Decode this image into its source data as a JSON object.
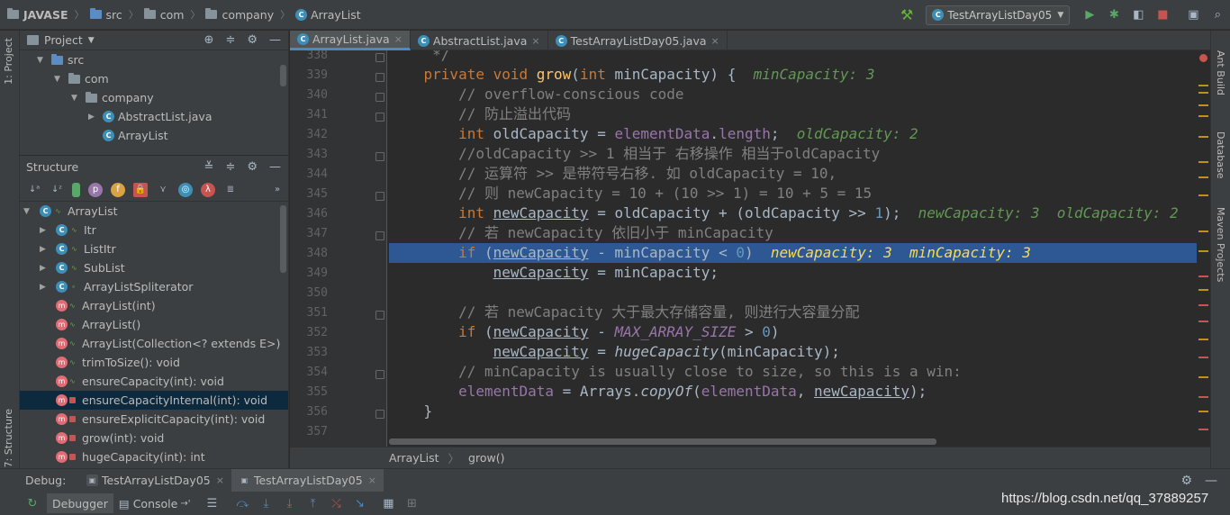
{
  "breadcrumbs": [
    "JAVASE",
    "src",
    "com",
    "company",
    "ArrayList"
  ],
  "run_config": "TestArrayListDay05",
  "left_strip": {
    "project_tab": "1: Project",
    "structure_tab": "7: Structure"
  },
  "right_strip": {
    "ant": "Ant Build",
    "database": "Database",
    "maven": "Maven Projects"
  },
  "project": {
    "title": "Project",
    "tree": [
      {
        "label": "src",
        "indent": 1,
        "arrow": "▼",
        "icon": "folder-blue"
      },
      {
        "label": "com",
        "indent": 2,
        "arrow": "▼",
        "icon": "folder"
      },
      {
        "label": "company",
        "indent": 3,
        "arrow": "▼",
        "icon": "folder"
      },
      {
        "label": "AbstractList.java",
        "indent": 4,
        "arrow": "▶",
        "icon": "class"
      },
      {
        "label": "ArrayList",
        "indent": 4,
        "arrow": "",
        "icon": "class"
      }
    ]
  },
  "structure": {
    "title": "Structure",
    "items": [
      {
        "label": "ArrayList",
        "indent": 0,
        "arrow": "▼",
        "kind": "class"
      },
      {
        "label": "Itr",
        "indent": 1,
        "arrow": "▶",
        "kind": "class"
      },
      {
        "label": "ListItr",
        "indent": 1,
        "arrow": "▶",
        "kind": "class"
      },
      {
        "label": "SubList",
        "indent": 1,
        "arrow": "▶",
        "kind": "class"
      },
      {
        "label": "ArrayListSpliterator",
        "indent": 1,
        "arrow": "▶",
        "kind": "class-static"
      },
      {
        "label": "ArrayList(int)",
        "indent": 1,
        "arrow": "",
        "kind": "method-public"
      },
      {
        "label": "ArrayList()",
        "indent": 1,
        "arrow": "",
        "kind": "method-public"
      },
      {
        "label": "ArrayList(Collection<? extends E>)",
        "indent": 1,
        "arrow": "",
        "kind": "method-public"
      },
      {
        "label": "trimToSize(): void",
        "indent": 1,
        "arrow": "",
        "kind": "method-public"
      },
      {
        "label": "ensureCapacity(int): void",
        "indent": 1,
        "arrow": "",
        "kind": "method-public"
      },
      {
        "label": "ensureCapacityInternal(int): void",
        "indent": 1,
        "arrow": "",
        "kind": "method-private",
        "selected": true
      },
      {
        "label": "ensureExplicitCapacity(int): void",
        "indent": 1,
        "arrow": "",
        "kind": "method-private"
      },
      {
        "label": "grow(int): void",
        "indent": 1,
        "arrow": "",
        "kind": "method-private"
      },
      {
        "label": "hugeCapacity(int): int",
        "indent": 1,
        "arrow": "",
        "kind": "method-private"
      }
    ]
  },
  "editor_tabs": [
    {
      "label": "ArrayList.java",
      "active": true
    },
    {
      "label": "AbstractList.java",
      "active": false
    },
    {
      "label": "TestArrayListDay05.java",
      "active": false
    }
  ],
  "code": {
    "line_numbers": [
      "338",
      "339",
      "340",
      "341",
      "342",
      "343",
      "344",
      "345",
      "346",
      "347",
      "348",
      "349",
      "350",
      "351",
      "352",
      "353",
      "354",
      "355",
      "356",
      "357"
    ],
    "highlight_line": "348"
  },
  "editor_breadcrumb": [
    "ArrayList",
    "grow()"
  ],
  "debug": {
    "label": "Debug:",
    "tabs": [
      {
        "label": "TestArrayListDay05",
        "active": false
      },
      {
        "label": "TestArrayListDay05",
        "active": true
      }
    ],
    "debugger_tab": "Debugger",
    "console_tab": "Console"
  },
  "watermark": "https://blog.csdn.net/qq_37889257",
  "colors": {
    "keyword": "#cc7832",
    "method": "#ffc66d",
    "comment": "#808080",
    "field": "#9876aa",
    "number": "#6897bb",
    "debug_value": "#629755",
    "selection": "#2d5893"
  }
}
